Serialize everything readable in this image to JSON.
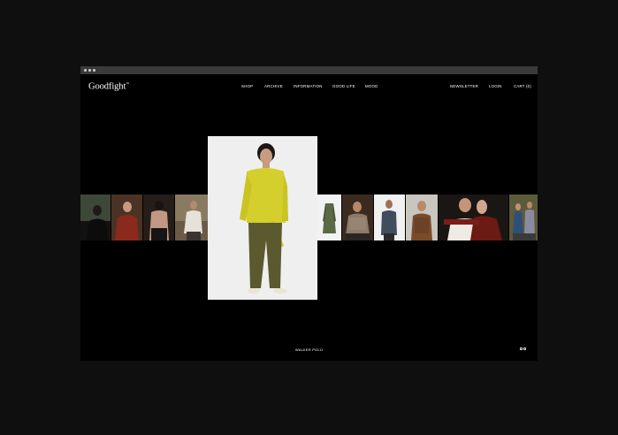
{
  "brand": {
    "logo": "Goodfight",
    "logo_mark": "™"
  },
  "nav": {
    "main": [
      "SHOP",
      "ARCHIVE",
      "INFORMATION",
      "GOOD LIFE",
      "MOOD"
    ],
    "newsletter": "NEWSLETTER",
    "login": "LOGIN",
    "cart": "CART (0)"
  },
  "featured": {
    "caption": "WALKER POLO"
  },
  "colors": {
    "background": "#000000",
    "text": "#ffffff",
    "sweater": "#d4cf2c",
    "pants": "#5b5a2f",
    "coat": "#5b6a45"
  }
}
